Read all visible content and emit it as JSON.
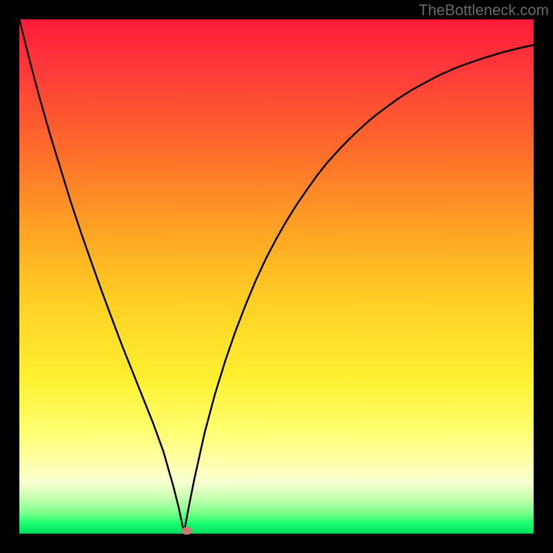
{
  "watermark": "TheBottleneck.com",
  "chart_data": {
    "type": "line",
    "title": "",
    "xlabel": "",
    "ylabel": "",
    "xlim": [
      0,
      1
    ],
    "ylim": [
      0,
      1
    ],
    "grid": false,
    "x_min_at": 0.32,
    "marker": {
      "x": 0.325,
      "y": 0.006,
      "color": "#c77a6f"
    },
    "series": [
      {
        "name": "curve",
        "color": "#000000",
        "x": [
          0.0,
          0.02,
          0.04,
          0.06,
          0.08,
          0.1,
          0.12,
          0.14,
          0.16,
          0.18,
          0.2,
          0.22,
          0.24,
          0.26,
          0.28,
          0.3,
          0.31,
          0.32,
          0.33,
          0.34,
          0.36,
          0.38,
          0.4,
          0.42,
          0.44,
          0.46,
          0.48,
          0.5,
          0.52,
          0.54,
          0.56,
          0.58,
          0.6,
          0.62,
          0.64,
          0.66,
          0.68,
          0.7,
          0.72,
          0.74,
          0.76,
          0.78,
          0.8,
          0.82,
          0.84,
          0.86,
          0.88,
          0.9,
          0.92,
          0.94,
          0.96,
          0.98,
          1.0
        ],
        "y": [
          1.0,
          0.92,
          0.845,
          0.775,
          0.71,
          0.645,
          0.585,
          0.528,
          0.472,
          0.418,
          0.365,
          0.315,
          0.265,
          0.215,
          0.16,
          0.09,
          0.05,
          0.002,
          0.055,
          0.105,
          0.195,
          0.27,
          0.335,
          0.393,
          0.445,
          0.493,
          0.536,
          0.574,
          0.609,
          0.641,
          0.67,
          0.698,
          0.723,
          0.745,
          0.766,
          0.785,
          0.803,
          0.819,
          0.834,
          0.848,
          0.861,
          0.872,
          0.883,
          0.893,
          0.902,
          0.91,
          0.917,
          0.924,
          0.93,
          0.936,
          0.941,
          0.946,
          0.95
        ]
      }
    ],
    "background_gradient": {
      "top": "#ff1a3a",
      "middle": "#ffd024",
      "bottom": "#00e060"
    }
  }
}
